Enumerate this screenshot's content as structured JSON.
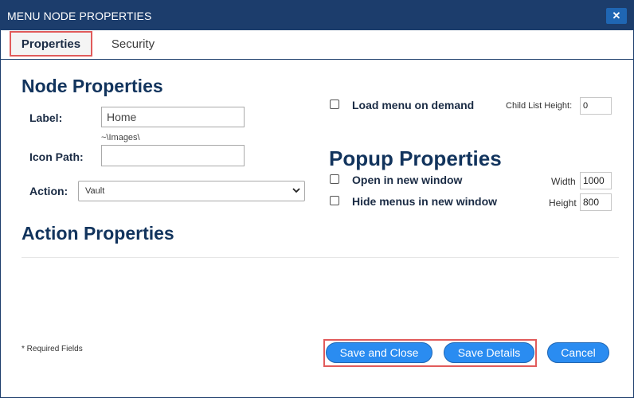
{
  "window": {
    "title": "MENU NODE PROPERTIES",
    "close_glyph": "✕"
  },
  "tabs": [
    {
      "label": "Properties",
      "active": true
    },
    {
      "label": "Security",
      "active": false
    }
  ],
  "node_properties": {
    "heading": "Node Properties",
    "label_field": {
      "label": "Label:",
      "value": "Home"
    },
    "icon_path": {
      "label": "Icon Path:",
      "hint": "~\\Images\\",
      "value": ""
    },
    "action": {
      "label": "Action:",
      "selected": "Vault"
    }
  },
  "load_on_demand": {
    "label": "Load menu on demand",
    "checked": false
  },
  "child_list_height": {
    "label": "Child List Height:",
    "value": "0"
  },
  "popup_properties": {
    "heading": "Popup Properties",
    "open_new_window": {
      "label": "Open in new window",
      "checked": false
    },
    "hide_menus": {
      "label": "Hide menus in new window",
      "checked": false
    },
    "width": {
      "label": "Width",
      "value": "1000"
    },
    "height": {
      "label": "Height",
      "value": "800"
    }
  },
  "action_properties": {
    "heading": "Action Properties"
  },
  "footer": {
    "required_note": "* Required Fields",
    "save_close": "Save and Close",
    "save_details": "Save Details",
    "cancel": "Cancel"
  },
  "colors": {
    "titlebar": "#1c3d6c",
    "accent": "#2a8cf1",
    "highlight": "#e15b5b"
  }
}
